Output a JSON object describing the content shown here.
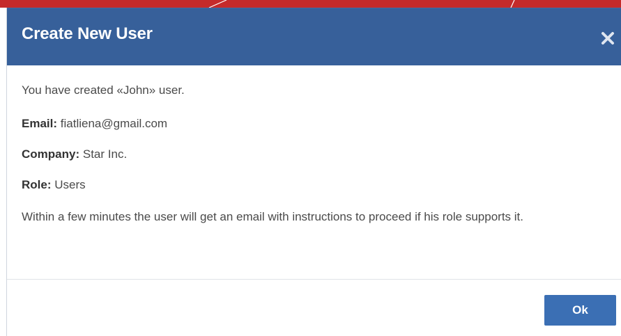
{
  "dialog": {
    "title": "Create New User",
    "close_icon": "close-icon",
    "created_prefix": "You have created «John» user.",
    "email_label": "Email:",
    "email_value": "fiatliena@gmail.com",
    "company_label": "Company:",
    "company_value": "Star Inc.",
    "role_label": "Role:",
    "role_value": "Users",
    "info_text": "Within a few minutes the user will get an email with instructions to proceed if his role supports it.",
    "ok_label": "Ok"
  },
  "colors": {
    "header_bg": "#37609a",
    "top_bar": "#c52a2a",
    "ok_button": "#3b6fb4"
  }
}
